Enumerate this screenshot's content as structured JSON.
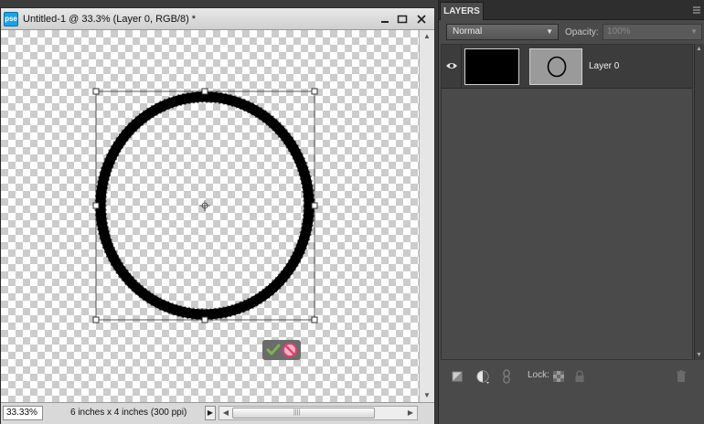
{
  "document": {
    "logo_text": "pse",
    "title": "Untitled-1 @ 33.3% (Layer 0, RGB/8) *",
    "zoom": "33.33%",
    "doc_info": "6 inches x 4 inches (300 ppi)"
  },
  "layers_panel": {
    "tab_label": "LAYERS",
    "blend_mode": "Normal",
    "opacity_label": "Opacity:",
    "opacity_value": "100%",
    "lock_label": "Lock:",
    "layers": [
      {
        "name": "Layer 0",
        "visible": true
      }
    ]
  },
  "icons": {
    "commit": "check-icon",
    "cancel": "cancel-icon",
    "visibility": "eye-icon",
    "new_layer": "new-layer-icon",
    "adjustment": "adjustment-layer-icon",
    "link": "link-icon",
    "lock_transparency": "lock-transparency-icon",
    "lock_all": "lock-icon",
    "delete": "trash-icon"
  },
  "colors": {
    "commit_green": "#7ab648",
    "cancel_pink": "#e04070",
    "panel_bg": "#4a4a4a"
  }
}
